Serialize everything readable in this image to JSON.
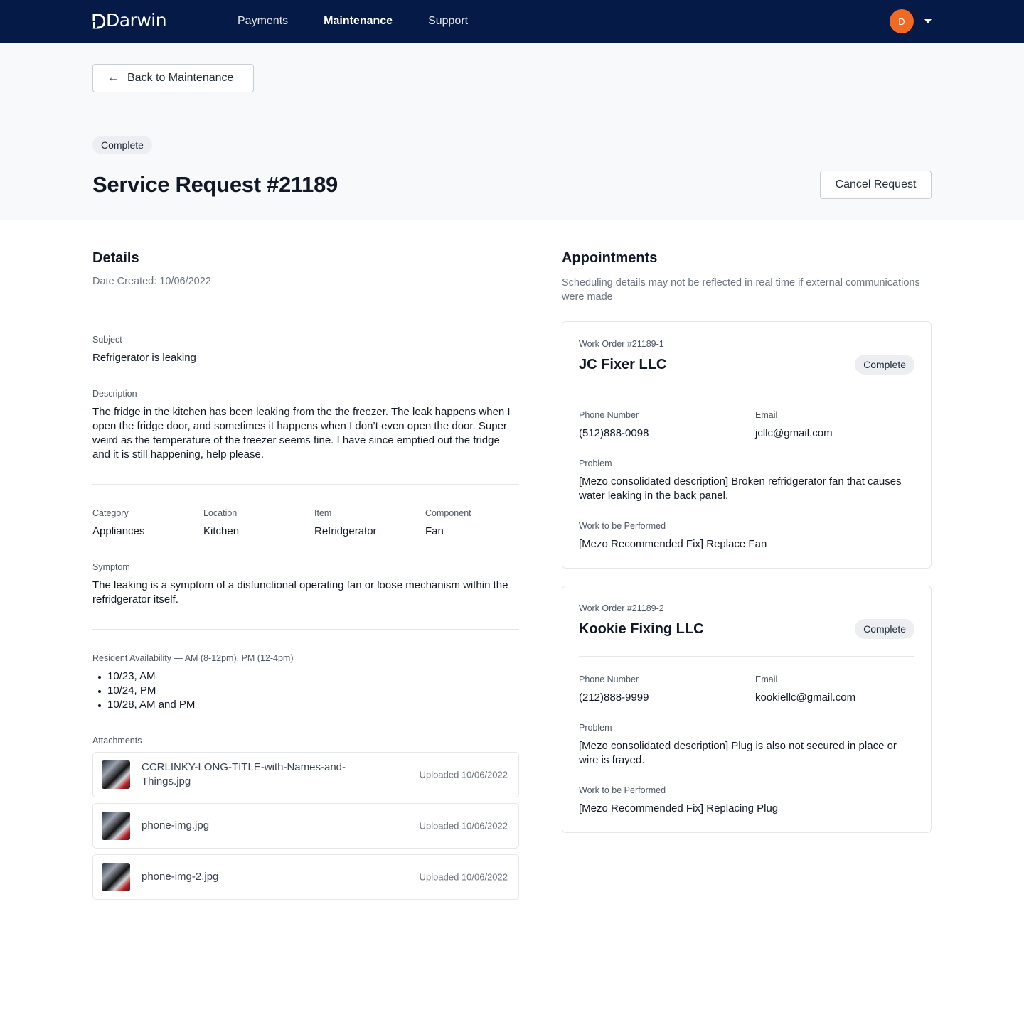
{
  "nav": {
    "brand": "Darwin",
    "links": [
      {
        "label": "Payments"
      },
      {
        "label": "Maintenance"
      },
      {
        "label": "Support"
      }
    ],
    "avatar_initial": "D"
  },
  "header": {
    "back_label": "Back to Maintenance",
    "status": "Complete",
    "title": "Service Request #21189",
    "cancel_label": "Cancel Request"
  },
  "details": {
    "heading": "Details",
    "date_created": "Date Created: 10/06/2022",
    "subject_label": "Subject",
    "subject": "Refrigerator is leaking",
    "description_label": "Description",
    "description": "The fridge in the kitchen has been leaking from the the freezer. The leak happens when I open the fridge door, and sometimes it happens when I don’t even open the door. Super weird as the temperature of the freezer seems fine. I have since emptied out the fridge and it is still happening, help please.",
    "category_label": "Category",
    "category": "Appliances",
    "location_label": "Location",
    "location": "Kitchen",
    "item_label": "Item",
    "item": "Refridgerator",
    "component_label": "Component",
    "component": "Fan",
    "symptom_label": "Symptom",
    "symptom": "The leaking is a symptom of a disfunctional operating fan or loose mechanism within the refridgerator itself.",
    "availability_label": "Resident Availability — AM (8-12pm), PM (12-4pm)",
    "availability": [
      "10/23, AM",
      "10/24, PM",
      "10/28, AM and PM"
    ],
    "attachments_label": "Attachments",
    "attachments": [
      {
        "name": "CCRLINKY-LONG-TITLE-with-Names-and-Things.jpg",
        "uploaded": "Uploaded 10/06/2022"
      },
      {
        "name": "phone-img.jpg",
        "uploaded": "Uploaded 10/06/2022"
      },
      {
        "name": "phone-img-2.jpg",
        "uploaded": "Uploaded 10/06/2022"
      }
    ]
  },
  "appointments": {
    "heading": "Appointments",
    "note": "Scheduling details may not be reflected in real time if external communications were made",
    "work_orders": [
      {
        "number": "Work Order #21189-1",
        "vendor": "JC Fixer LLC",
        "status": "Complete",
        "phone_label": "Phone Number",
        "phone": "(512)888-0098",
        "email_label": "Email",
        "email": "jcllc@gmail.com",
        "problem_label": "Problem",
        "problem": "[Mezo consolidated description] Broken refridgerator fan that causes water leaking in the back panel.",
        "work_label": "Work to be Performed",
        "work": "[Mezo Recommended Fix] Replace Fan"
      },
      {
        "number": "Work Order #21189-2",
        "vendor": "Kookie Fixing LLC",
        "status": "Complete",
        "phone_label": "Phone Number",
        "phone": "(212)888-9999",
        "email_label": "Email",
        "email": "kookiellc@gmail.com",
        "problem_label": "Problem",
        "problem": "[Mezo consolidated description] Plug is also not secured in place or wire is frayed.",
        "work_label": "Work to be Performed",
        "work": "[Mezo Recommended Fix] Replacing Plug"
      }
    ]
  },
  "colors": {
    "nav_bg": "#051a47",
    "avatar_bg": "#f26a21",
    "band_bg": "#f8f9fb",
    "pill_bg": "#eceef1"
  }
}
